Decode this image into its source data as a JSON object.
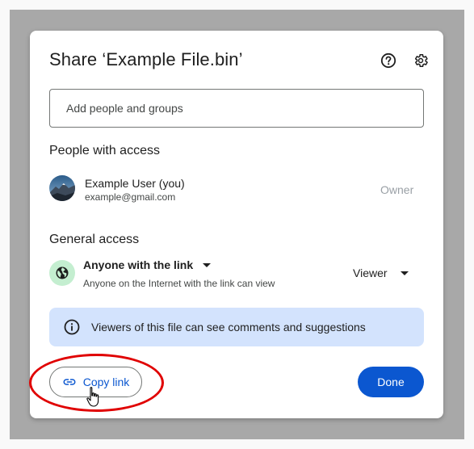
{
  "dialog": {
    "title": "Share ‘Example File.bin’",
    "help_icon": "help-circle-icon",
    "settings_icon": "gear-icon"
  },
  "add_people": {
    "placeholder": "Add people and groups"
  },
  "people_access": {
    "title": "People with access",
    "users": [
      {
        "name": "Example User (you)",
        "email": "example@gmail.com",
        "role": "Owner"
      }
    ]
  },
  "general_access": {
    "title": "General access",
    "scope_label": "Anyone with the link",
    "scope_description": "Anyone on the Internet with the link can view",
    "role_label": "Viewer"
  },
  "info_banner": {
    "text": "Viewers of this file can see comments and suggestions"
  },
  "footer": {
    "copy_link_label": "Copy link",
    "done_label": "Done"
  },
  "colors": {
    "primary": "#0b57d0",
    "banner_bg": "#d3e3fd",
    "globe_bg": "#c4eed0",
    "highlight": "#e00000"
  }
}
